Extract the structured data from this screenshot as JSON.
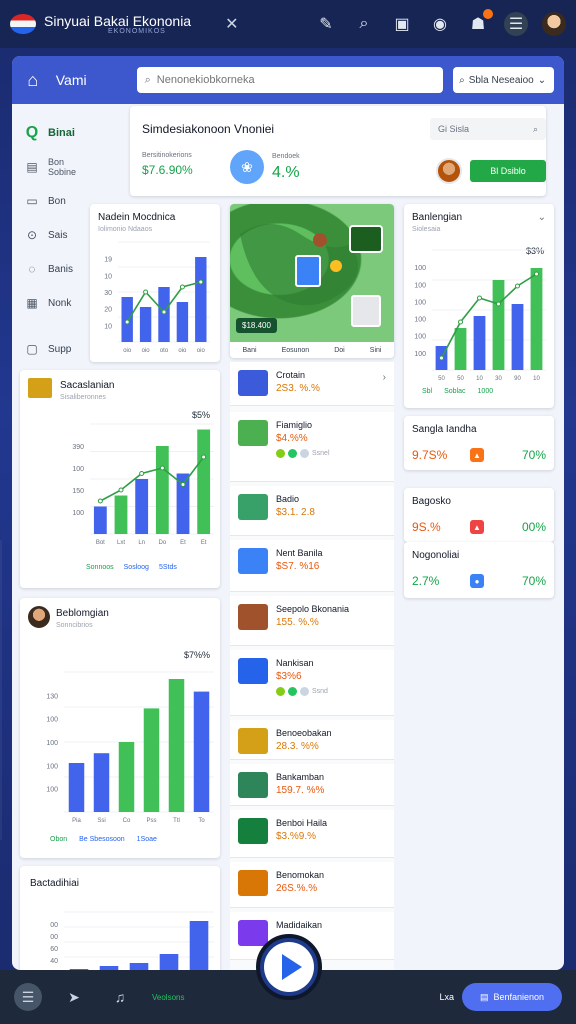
{
  "topbar": {
    "title": "Sinyuai Bakai Ekononia",
    "subtitle": "EKONOMIKOS",
    "close": "✕"
  },
  "header": {
    "title": "Vami",
    "search_placeholder": "Nenonekiobkorneka",
    "region": "Sbla Neseaioo"
  },
  "sidebar": {
    "items": [
      {
        "label": "Binai",
        "icon": "globe-icon",
        "active": true
      },
      {
        "label": "Bon",
        "sub": "Sobine",
        "icon": "chart-icon"
      },
      {
        "label": "Bon",
        "icon": "document-icon"
      },
      {
        "label": "Sais",
        "icon": "settings-icon"
      },
      {
        "label": "Banis",
        "icon": "chat-icon"
      },
      {
        "label": "Nonk",
        "icon": "table-icon"
      },
      {
        "label": "Supp",
        "icon": "support-icon"
      }
    ]
  },
  "summary": {
    "title": "Simdesiakonoon Vnoniei",
    "filter": "Gi Sisla",
    "kpi1_label": "Bersitinokerions",
    "kpi1_value": "$7.6.90%",
    "kpi2_label": "Bendoek",
    "kpi2_value": "4.%",
    "details_label": "Bl Dsiblo"
  },
  "chart_cards": {
    "c1": {
      "title": "Nadein Mocdnica",
      "sub": "Iolimonio Ndaaos"
    },
    "c2": {
      "title": "Banlengian",
      "sub": "Siolesaia",
      "value": "$3%",
      "legend": [
        "Sbl",
        "Soblac",
        "1000"
      ]
    },
    "c3": {
      "title": "Sacaslanian",
      "sub": "Sisaliberonnes",
      "value": "$5%",
      "legend": [
        "Sonnoos",
        "Sosloog",
        "5Stds"
      ]
    },
    "c4": {
      "title": "Beblomgian",
      "sub": "Sonncibrios",
      "value": "$7%%",
      "legend": [
        "Obon",
        "Be Sbesosoon",
        "1Soae"
      ]
    },
    "c5": {
      "title": "Bactadihiai"
    }
  },
  "chart_data": [
    {
      "type": "bar",
      "title": "Nadein Mocdnica",
      "categories": [
        "oio",
        "oio",
        "oto",
        "oio",
        "oio"
      ],
      "values": [
        45,
        35,
        55,
        40,
        85
      ],
      "series": [
        {
          "name": "trend",
          "values": [
            20,
            50,
            30,
            55,
            60
          ]
        }
      ],
      "ylim": [
        0,
        100
      ],
      "ylabel_ticks": [
        "19",
        "10",
        "30",
        "20",
        "10"
      ]
    },
    {
      "type": "bar",
      "title": "Banlengian",
      "categories": [
        "50",
        "50",
        "10",
        "30",
        "90",
        "10"
      ],
      "values": [
        20,
        35,
        45,
        75,
        55,
        85
      ],
      "series": [
        {
          "name": "trend",
          "values": [
            10,
            40,
            60,
            55,
            70,
            80
          ]
        }
      ],
      "ylim": [
        0,
        100
      ],
      "ylabel_ticks": [
        "100",
        "100",
        "100",
        "100",
        "100",
        "100"
      ]
    },
    {
      "type": "bar",
      "title": "Sacaslanian",
      "categories": [
        "Bot",
        "Lxt",
        "Ln",
        "Do",
        "Et",
        "Et"
      ],
      "values": [
        25,
        35,
        50,
        80,
        55,
        95
      ],
      "series": [
        {
          "name": "trend",
          "values": [
            30,
            40,
            55,
            60,
            45,
            70
          ]
        }
      ],
      "ylim": [
        0,
        100
      ],
      "ylabel_ticks": [
        "390",
        "100",
        "150",
        "100"
      ]
    },
    {
      "type": "bar",
      "title": "Beblomgian",
      "categories": [
        "Pia",
        "Ssi",
        "Co",
        "Pss",
        "Ttl",
        "To"
      ],
      "values": [
        35,
        42,
        50,
        74,
        95,
        86
      ],
      "ylim": [
        0,
        100
      ],
      "ylabel_ticks": [
        "130",
        "100",
        "100",
        "100",
        "100"
      ]
    },
    {
      "type": "bar",
      "title": "Bactadihiai",
      "categories": [
        "",
        "",
        "",
        "",
        ""
      ],
      "values": [
        5,
        10,
        15,
        30,
        85
      ],
      "ylim": [
        0,
        100
      ],
      "ylabel_ticks": [
        "00",
        "00",
        "60",
        "40"
      ]
    }
  ],
  "map": {
    "badge": "$18.400",
    "tabs": [
      "Bani",
      "Eosunon",
      "Doi",
      "Sini"
    ]
  },
  "mid_list": [
    {
      "name": "Crotain",
      "value": "2S3. %.%",
      "icon_color": "#3b5bdb",
      "icon": "grid-icon",
      "chevron": true
    },
    {
      "name": "Fiamiglio",
      "value": "$4.%%",
      "icon_color": "#4caf50",
      "icon": "coins-icon",
      "dots": true,
      "dots_label": "Ssnel"
    },
    {
      "name": "Badio",
      "value": "$3.1. 2.8",
      "icon_color": "#38a169",
      "icon": "plug-icon"
    },
    {
      "name": "Nent Banila",
      "value": "$S7. %16",
      "icon_color": "#3b82f6",
      "icon": "building-icon"
    },
    {
      "name": "Seepolo Bkonania",
      "value": "155. %.%",
      "icon_color": "#a0522d",
      "icon": "medal-icon"
    },
    {
      "name": "Nankisan",
      "value": "$3%6",
      "icon_color": "#2563eb",
      "icon": "gear-icon",
      "dots": true,
      "dots_label": "Ssnd"
    },
    {
      "name": "Benoeobakan",
      "value": "28.3. %%",
      "icon_color": "#d4a017",
      "icon": "coin-stack-icon"
    },
    {
      "name": "Bankamban",
      "value": "159.7. %%",
      "icon_color": "#2f855a",
      "icon": "money-icon"
    },
    {
      "name": "Benboi Haila",
      "value": "$3.%9.%",
      "icon_color": "#15803d",
      "icon": "bank-icon"
    },
    {
      "name": "Benomokan",
      "value": "26S.%.%",
      "icon_color": "#d97706",
      "icon": "map-icon"
    },
    {
      "name": "Madidaikan",
      "value": "",
      "icon_color": "#7c3aed",
      "icon": "people-icon"
    }
  ],
  "stats": [
    {
      "name": "Sangla Iandha",
      "left": "9.7S%",
      "right": "70%",
      "ic_color": "#f97316"
    },
    {
      "name": "Bagosko",
      "left": "9S.%",
      "right": "00%",
      "ic_color": "#ef4444"
    },
    {
      "name": "Nogonoliai",
      "left": "2.7%",
      "right": "70%",
      "ic_color": "#3b82f6"
    }
  ],
  "bottom": {
    "label": "Veolsons",
    "right_text": "Lxa",
    "subscribe": "Benfanienon"
  }
}
